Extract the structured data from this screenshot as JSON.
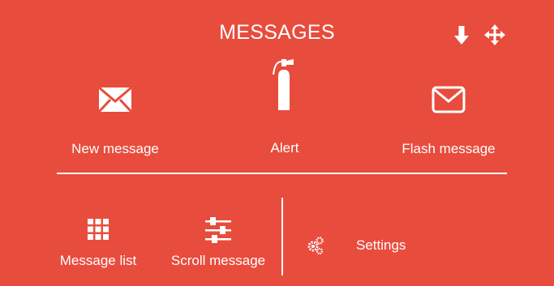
{
  "header": {
    "title": "MESSAGES",
    "icons": [
      "arrow-down-icon",
      "move-arrows-icon"
    ]
  },
  "tiles": [
    {
      "label": "New message",
      "icon": "envelope-filled-icon"
    },
    {
      "label": "Alert",
      "icon": "fire-extinguisher-icon"
    },
    {
      "label": "Flash message",
      "icon": "envelope-outline-icon"
    }
  ],
  "bottom": [
    {
      "label": "Message list",
      "icon": "grid-icon"
    },
    {
      "label": "Scroll message",
      "icon": "sliders-icon"
    },
    {
      "label": "Settings",
      "icon": "gears-icon"
    }
  ],
  "colors": {
    "background": "#e84c3d",
    "foreground": "#ffffff"
  }
}
